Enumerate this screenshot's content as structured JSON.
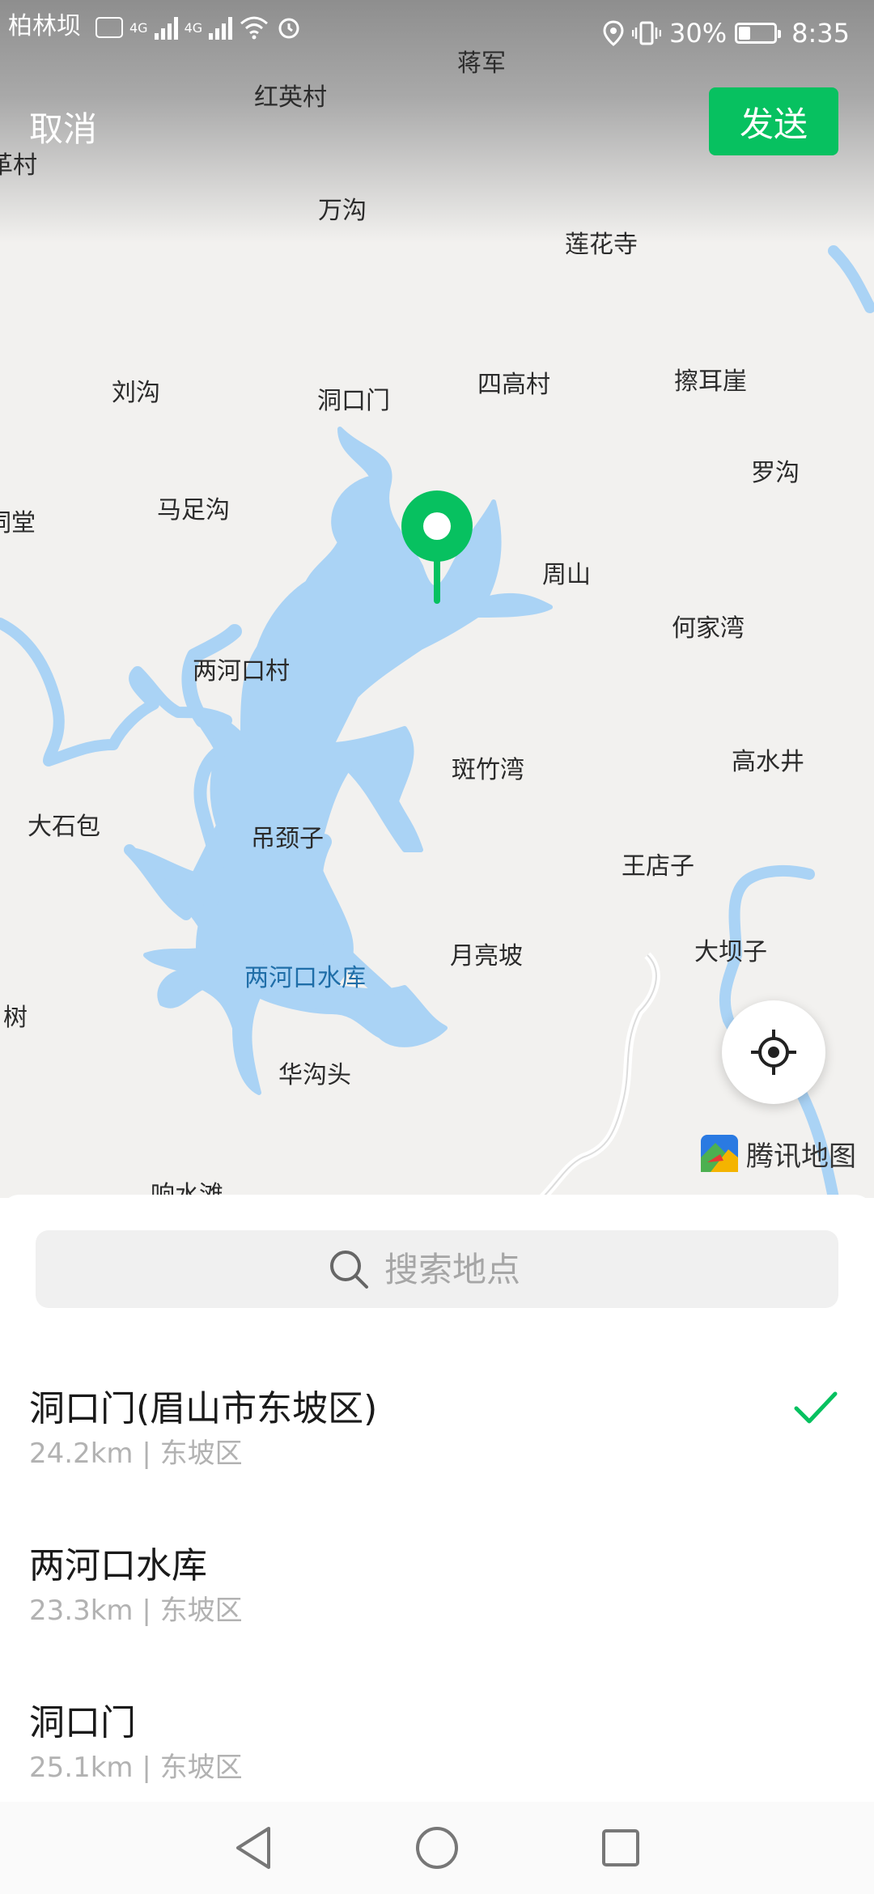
{
  "status_bar": {
    "carrier": "柏林坝",
    "network_1": "4G",
    "network_2": "4G",
    "battery_percent": "30%",
    "battery_level": 0.3,
    "time": "8:35"
  },
  "header": {
    "cancel_label": "取消",
    "send_label": "发送",
    "accent_color": "#07c160"
  },
  "map": {
    "places": [
      {
        "name": "柏林坝"
      },
      {
        "name": "蒋军"
      },
      {
        "name": "红英村"
      },
      {
        "name": "革村"
      },
      {
        "name": "万沟"
      },
      {
        "name": "莲花寺"
      },
      {
        "name": "刘沟"
      },
      {
        "name": "洞口门"
      },
      {
        "name": "四高村"
      },
      {
        "name": "擦耳崖"
      },
      {
        "name": "罗沟"
      },
      {
        "name": "祠堂"
      },
      {
        "name": "马足沟"
      },
      {
        "name": "周山"
      },
      {
        "name": "何家湾"
      },
      {
        "name": "两河口村"
      },
      {
        "name": "斑竹湾"
      },
      {
        "name": "高水井"
      },
      {
        "name": "大石包"
      },
      {
        "name": "吊颈子"
      },
      {
        "name": "王店子"
      },
      {
        "name": "两河口水库"
      },
      {
        "name": "月亮坡"
      },
      {
        "name": "大坝子"
      },
      {
        "name": "树"
      },
      {
        "name": "华沟头"
      },
      {
        "name": "响水滩"
      }
    ],
    "logo_text": "腾讯地图",
    "water_color": "#aad3f5",
    "pin_color": "#07c160"
  },
  "search": {
    "placeholder": "搜索地点"
  },
  "results": [
    {
      "name": "洞口门(眉山市东坡区)",
      "distance": "24.2km",
      "district": "东坡区",
      "selected": true
    },
    {
      "name": "两河口水库",
      "distance": "23.3km",
      "district": "东坡区",
      "selected": false
    },
    {
      "name": "洞口门",
      "distance": "25.1km",
      "district": "东坡区",
      "selected": false
    }
  ],
  "separator": " | "
}
